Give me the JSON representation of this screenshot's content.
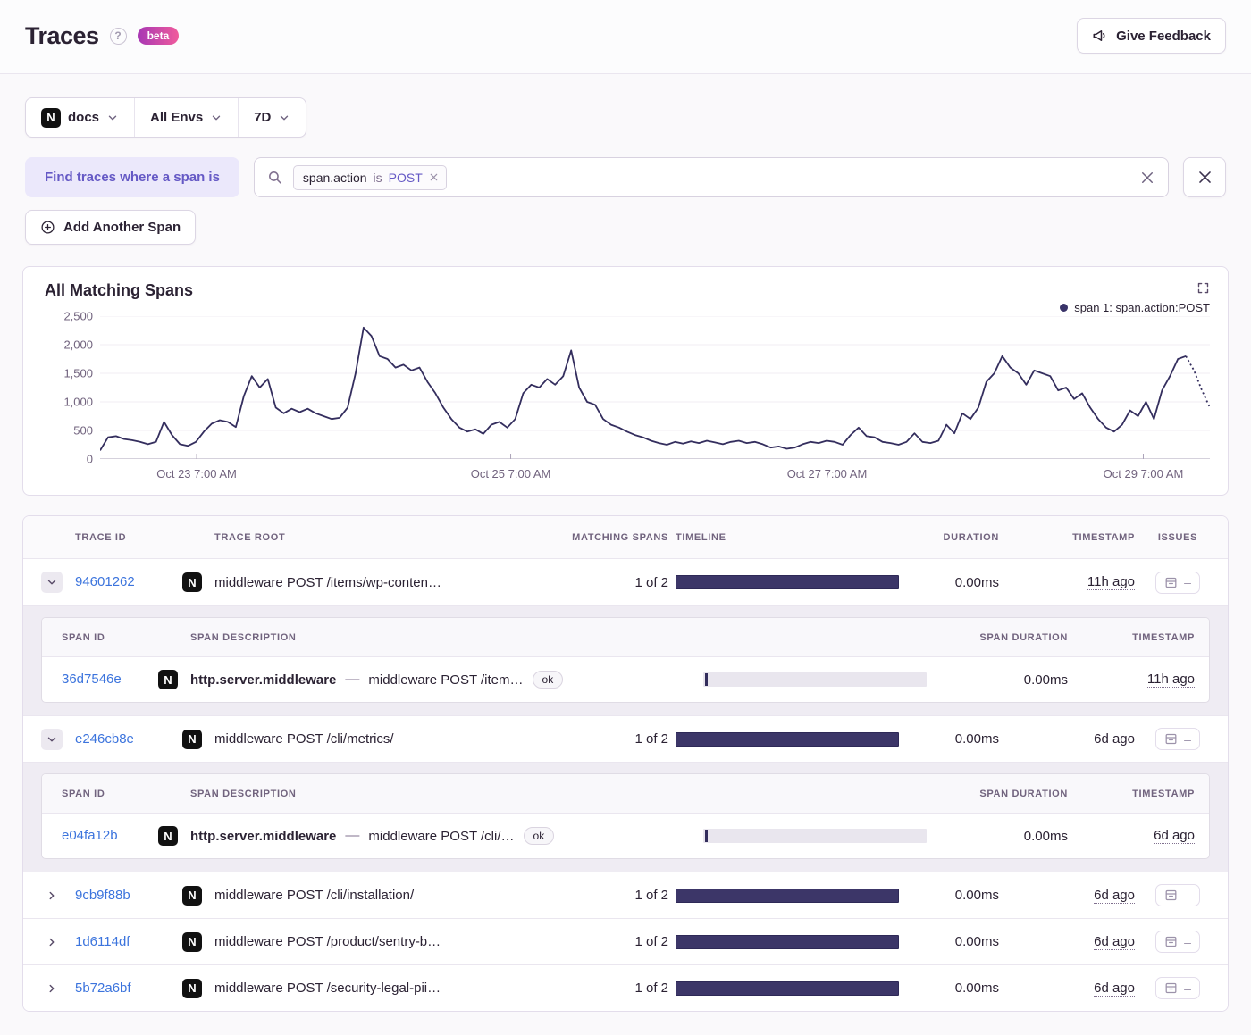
{
  "header": {
    "title": "Traces",
    "beta_label": "beta",
    "feedback_label": "Give Feedback"
  },
  "filters": {
    "project": "docs",
    "environment": "All Envs",
    "period": "7D"
  },
  "query": {
    "where_label": "Find traces where a span is",
    "token": {
      "key": "span.action",
      "op": "is",
      "value": "POST"
    },
    "add_span_label": "Add Another Span"
  },
  "chart": {
    "title": "All Matching Spans",
    "legend": "span 1: span.action:POST",
    "chart_data": {
      "type": "line",
      "title": "All Matching Spans",
      "series_name": "span 1: span.action:POST",
      "line_color": "#342e5e",
      "ylim": [
        0,
        2500
      ],
      "y_ticks": [
        {
          "value": 2500,
          "label": "2,500"
        },
        {
          "value": 2000,
          "label": "2,000"
        },
        {
          "value": 1500,
          "label": "1,500"
        },
        {
          "value": 1000,
          "label": "1,000"
        },
        {
          "value": 500,
          "label": "500"
        },
        {
          "value": 0,
          "label": "0"
        }
      ],
      "x_ticks": [
        {
          "label": "Oct 23 7:00 AM",
          "frac": 0.087
        },
        {
          "label": "Oct 25 7:00 AM",
          "frac": 0.37
        },
        {
          "label": "Oct 27 7:00 AM",
          "frac": 0.655
        },
        {
          "label": "Oct 29 7:00 AM",
          "frac": 0.94
        }
      ],
      "dashed_tail_points": 4,
      "values": [
        150,
        380,
        400,
        350,
        330,
        300,
        260,
        300,
        650,
        420,
        260,
        230,
        300,
        480,
        620,
        680,
        650,
        560,
        1100,
        1450,
        1250,
        1400,
        900,
        800,
        880,
        820,
        880,
        800,
        750,
        700,
        720,
        900,
        1500,
        2300,
        2150,
        1800,
        1750,
        1600,
        1650,
        1550,
        1600,
        1350,
        1150,
        900,
        700,
        550,
        480,
        520,
        440,
        600,
        650,
        550,
        700,
        1150,
        1300,
        1250,
        1400,
        1300,
        1450,
        1900,
        1250,
        1000,
        950,
        700,
        600,
        550,
        480,
        420,
        380,
        320,
        280,
        250,
        300,
        270,
        310,
        280,
        320,
        290,
        260,
        300,
        320,
        280,
        300,
        260,
        200,
        220,
        180,
        200,
        260,
        300,
        280,
        320,
        300,
        250,
        420,
        550,
        400,
        380,
        300,
        280,
        250,
        300,
        450,
        300,
        280,
        320,
        600,
        450,
        800,
        700,
        900,
        1350,
        1500,
        1800,
        1600,
        1500,
        1300,
        1550,
        1500,
        1450,
        1200,
        1250,
        1050,
        1150,
        900,
        700,
        550,
        480,
        600,
        850,
        750,
        1000,
        700,
        1200,
        1450,
        1750,
        1800,
        1550,
        1200,
        900
      ]
    }
  },
  "table": {
    "columns": [
      "Trace ID",
      "Trace Root",
      "Matching Spans",
      "Timeline",
      "Duration",
      "Timestamp",
      "Issues"
    ],
    "span_columns": [
      "Span ID",
      "Span Description",
      "Span Duration",
      "Timestamp"
    ],
    "rows": [
      {
        "id": "94601262",
        "expanded": true,
        "root": "middleware POST /items/wp-conten…",
        "matching": "1 of 2",
        "duration": "0.00ms",
        "age": "11h ago",
        "spans": [
          {
            "id": "36d7546e",
            "op": "http.server.middleware",
            "desc": "middleware POST /item…",
            "status": "ok",
            "duration": "0.00ms",
            "age": "11h ago"
          }
        ]
      },
      {
        "id": "e246cb8e",
        "expanded": true,
        "root": "middleware POST /cli/metrics/",
        "matching": "1 of 2",
        "duration": "0.00ms",
        "age": "6d ago",
        "spans": [
          {
            "id": "e04fa12b",
            "op": "http.server.middleware",
            "desc": "middleware POST /cli/…",
            "status": "ok",
            "duration": "0.00ms",
            "age": "6d ago"
          }
        ]
      },
      {
        "id": "9cb9f88b",
        "expanded": false,
        "root": "middleware POST /cli/installation/",
        "matching": "1 of 2",
        "duration": "0.00ms",
        "age": "6d ago",
        "spans": []
      },
      {
        "id": "1d6114df",
        "expanded": false,
        "root": "middleware POST /product/sentry-b…",
        "matching": "1 of 2",
        "duration": "0.00ms",
        "age": "6d ago",
        "spans": []
      },
      {
        "id": "5b72a6bf",
        "expanded": false,
        "root": "middleware POST /security-legal-pii…",
        "matching": "1 of 2",
        "duration": "0.00ms",
        "age": "6d ago",
        "spans": []
      }
    ]
  }
}
